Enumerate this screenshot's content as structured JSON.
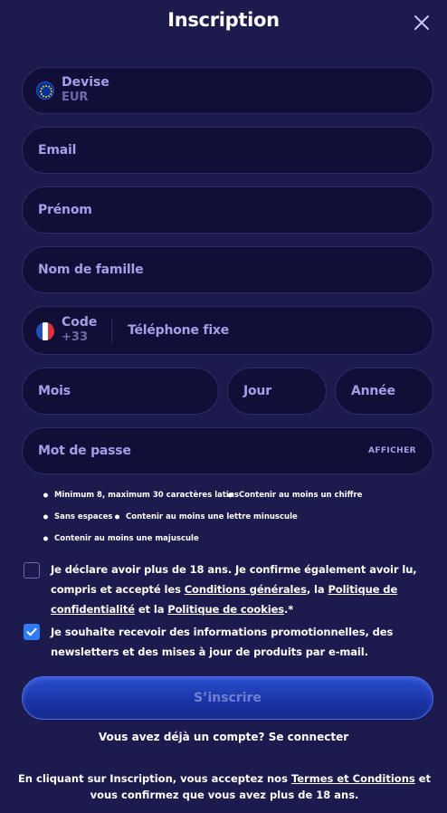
{
  "header": {
    "title": "Inscription"
  },
  "currency": {
    "label": "Devise",
    "value": "EUR"
  },
  "email": {
    "placeholder": "Email"
  },
  "first_name": {
    "placeholder": "Prénom"
  },
  "last_name": {
    "placeholder": "Nom de famille"
  },
  "phone": {
    "code_label": "Code",
    "code_value": "+33",
    "placeholder": "Téléphone fixe"
  },
  "birth": {
    "month": "Mois",
    "day": "Jour",
    "year": "Année"
  },
  "password": {
    "placeholder": "Mot de passe",
    "show_label": "AFFICHER"
  },
  "password_rules": [
    "Minimum 8, maximum 30 caractères latins",
    "Contenir au moins un chiffre",
    "Sans espaces",
    "Contenir au moins une lettre minuscule",
    "Contenir au moins une majuscule"
  ],
  "consent_age": {
    "checked": false,
    "text_1": "Je déclare avoir plus de 18 ans. Je confirme également avoir lu, compris et accepté les ",
    "link_1": "Conditions générales",
    "sep_1": ", la ",
    "link_2": "Politique de confidentialité",
    "sep_2": " et la ",
    "link_3": "Politique de cookies",
    "suffix": ".*"
  },
  "consent_promo": {
    "checked": true,
    "text": "Je souhaite recevoir des informations promotionnelles, des newsletters et des mises à jour de produits par e-mail."
  },
  "submit": {
    "label": "S’inscrire"
  },
  "login": {
    "question": "Vous avez déjà un compte?",
    "link": "Se connecter"
  },
  "terms": {
    "text_1": "En cliquant sur Inscription, vous acceptez nos ",
    "link": "Termes et Conditions",
    "text_2": " et vous confirmez que vous avez plus de 18 ans."
  },
  "colors": {
    "background": "#1d1a4d",
    "field": "#110f38",
    "label": "#a49fe6",
    "accent": "#2f7bf2"
  }
}
